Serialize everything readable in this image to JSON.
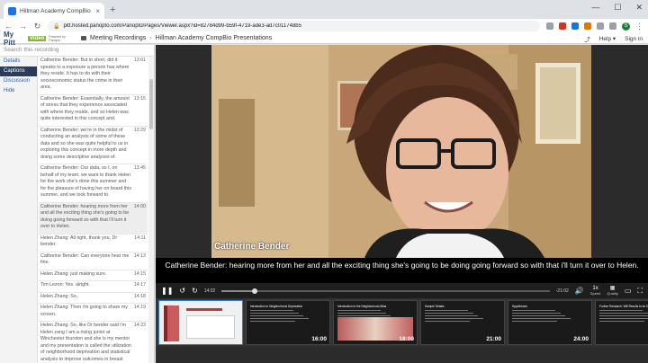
{
  "browser": {
    "tab_title": "Hillman Academy CompBio",
    "tab_close": "×",
    "new_tab": "+",
    "url": "pitt.hosted.panopto.com/Panopto/Pages/Viewer.aspx?id=82784d99-b59f-4719-ade3-ad7c011748b5",
    "avatar_letter": "S",
    "window_controls": [
      "—",
      "☐",
      "✕"
    ]
  },
  "header": {
    "logo_main": "My Pitt",
    "logo_box": "Video",
    "powered_by": "Powered by Panopto",
    "breadcrumb_folder": "Meeting Recordings",
    "breadcrumb_separator": "›",
    "breadcrumb_title": "Hillman Academy CompBio Presentations",
    "help_label": "Help ▾",
    "sign_in_label": "Sign in"
  },
  "sidebar": {
    "search_placeholder": "Search this recording",
    "tabs": [
      "Details",
      "Captions",
      "Discussion",
      "Hide"
    ],
    "active_tab": "Captions",
    "captions": [
      {
        "text": "Catherine Bender: But in short, did it speaks to a exposure a person has where they reside. It has to do with their socioeconomic status the crime in their area.",
        "time": "13:01",
        "highlight": false
      },
      {
        "text": "Catherine Bender: Essentially, the amount of stress that they experience associated with where they reside, and so Helen was quite interested in this concept and.",
        "time": "13:15",
        "highlight": false
      },
      {
        "text": "Catherine Bender: we're in the midst of conducting an analysis of some of these data and so she was quite helpful to us in exploring this concept in more depth and doing some descriptive analyses of.",
        "time": "13:29",
        "highlight": false
      },
      {
        "text": "Catherine Bender: Our data, so I, on behalf of my team, we want to thank Helen for the work she's done this summer and for the pleasure of having her on board this summer, and we look forward to.",
        "time": "13:45",
        "highlight": false
      },
      {
        "text": "Catherine Bender: hearing more from her and all the exciting thing she's going to be doing going forward so with that i'll turn it over to Helen.",
        "time": "14:00",
        "highlight": true
      },
      {
        "text": "Helen Zhang: All right, thank you, Dr bender.",
        "time": "14:11",
        "highlight": false
      },
      {
        "text": "Catherine Bender: Can everyone hear me fine.",
        "time": "14:13",
        "highlight": false
      },
      {
        "text": "Helen Zhang: just making sure.",
        "time": "14:15",
        "highlight": false
      },
      {
        "text": "Tim Lezon: Yes. alright.",
        "time": "14:17",
        "highlight": false
      },
      {
        "text": "Helen Zhang: So,",
        "time": "14:18",
        "highlight": false
      },
      {
        "text": "Helen Zhang: Then i'm going to share my screen.",
        "time": "14:19",
        "highlight": false
      },
      {
        "text": "Helen Zhang: So, like Dr bender said i'm Helen zang I am a rising junior at Winchester thurston and she is my mentor and my presentation is called the utilization of neighborhood deprivation and statistical analysis to improve outcomes in breast cancer.",
        "time": "14:23",
        "highlight": false
      }
    ]
  },
  "player": {
    "speaker_label": "Catherine Bender",
    "caption_text": "Catherine Bender: hearing more from her and all the exciting thing she's going to be doing going forward so with that i'll turn it over to Helen.",
    "elapsed": "14:02",
    "remaining": "-21:02",
    "speed_value": "1x",
    "speed_label": "Speed",
    "quality_label": "Quality",
    "progress_fraction": 0.1
  },
  "slides": [
    {
      "title": "",
      "time": ""
    },
    {
      "title": "Introduction to Neighborhood Deprivation",
      "time": "16:00"
    },
    {
      "title": "Introduction to the Neighborhood Atlas",
      "time": "18:00"
    },
    {
      "title": "Sample Details",
      "time": "21:00"
    },
    {
      "title": "Hypotheses",
      "time": "24:00"
    },
    {
      "title": "Further Research: Will Results to be Dis...",
      "time": ""
    }
  ]
}
